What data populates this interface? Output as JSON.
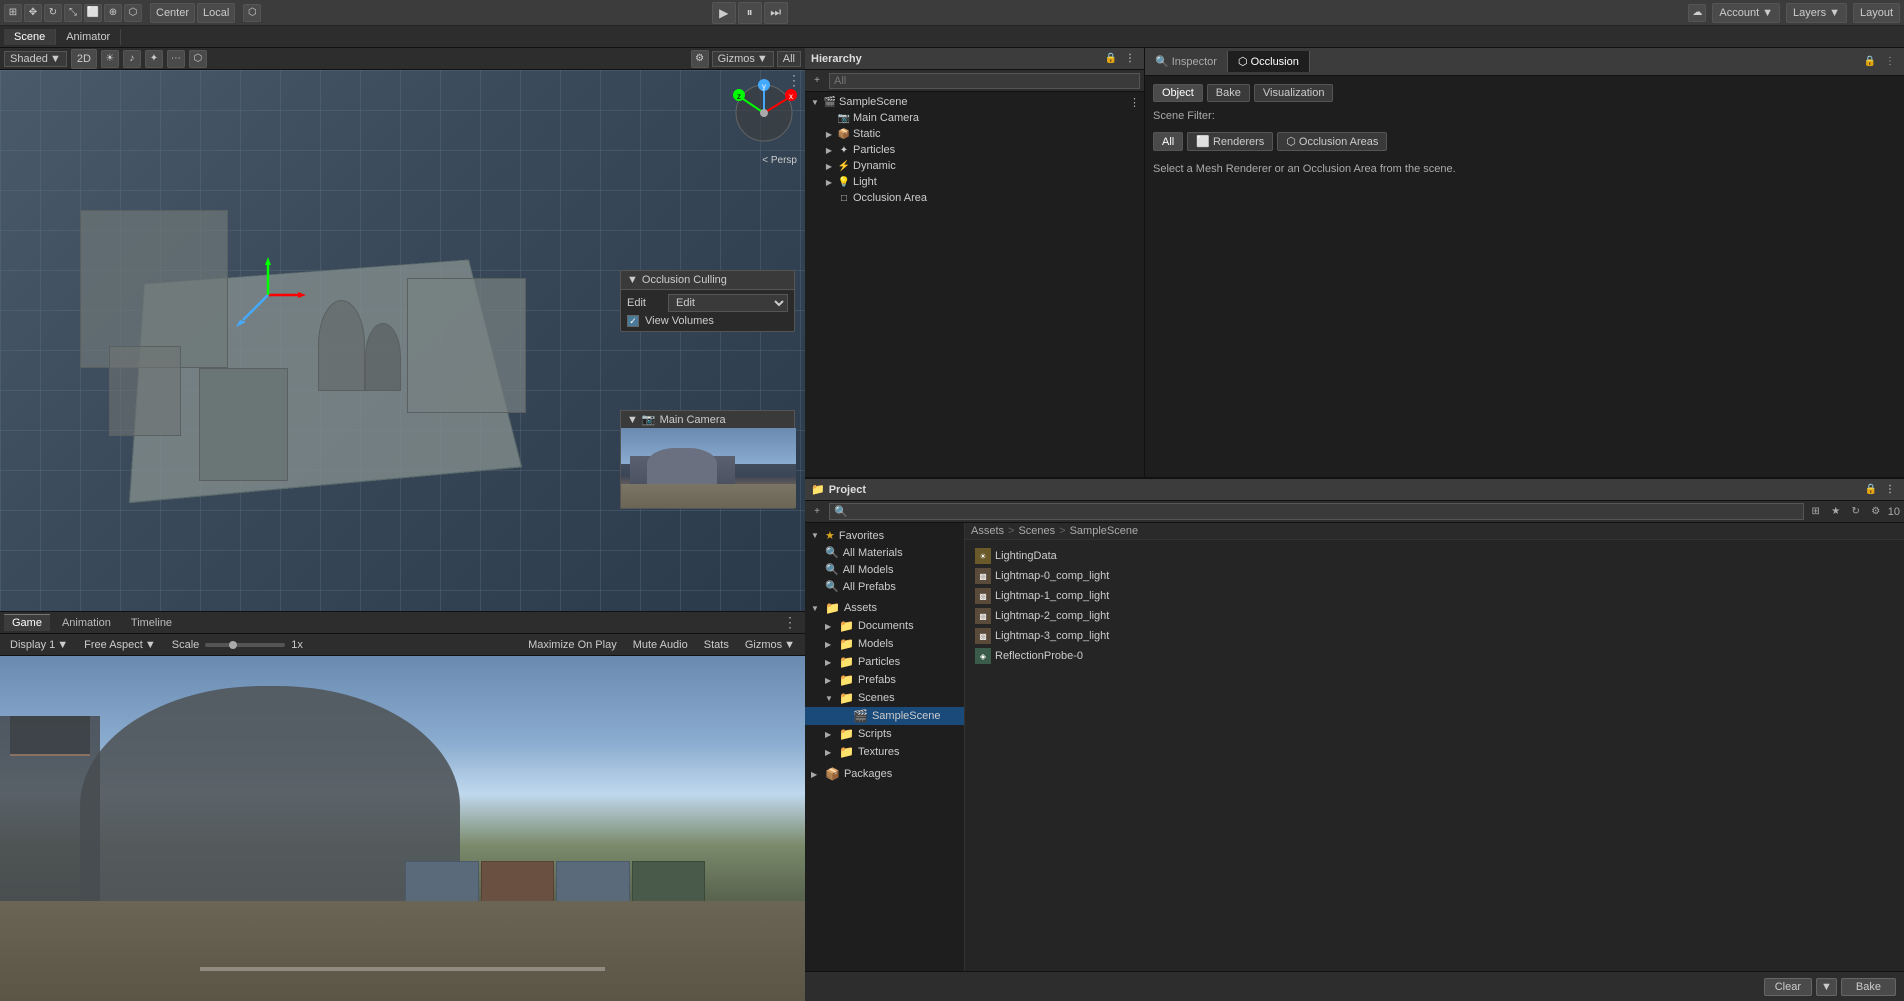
{
  "toolbar": {
    "scene_label": "Scene",
    "animator_label": "Animator",
    "shaded_label": "Shaded",
    "twod_label": "2D",
    "gizmos_label": "Gizmos",
    "all_label": "All",
    "center_label": "Center",
    "local_label": "Local",
    "play_icon": "▶",
    "pause_icon": "⏸",
    "step_icon": "⏭",
    "account_label": "Account",
    "layers_label": "Layers",
    "layout_label": "Layout"
  },
  "hierarchy": {
    "title": "Hierarchy",
    "search_placeholder": "All",
    "items": [
      {
        "label": "SampleScene",
        "indent": 0,
        "icon": "🎬",
        "arrow": "▼"
      },
      {
        "label": "Main Camera",
        "indent": 1,
        "icon": "📷",
        "arrow": ""
      },
      {
        "label": "Static",
        "indent": 1,
        "icon": "▶",
        "arrow": "▶"
      },
      {
        "label": "Particles",
        "indent": 1,
        "icon": "▶",
        "arrow": "▶"
      },
      {
        "label": "Dynamic",
        "indent": 1,
        "icon": "▶",
        "arrow": "▶"
      },
      {
        "label": "Light",
        "indent": 1,
        "icon": "💡",
        "arrow": "▶"
      },
      {
        "label": "Occlusion Area",
        "indent": 1,
        "icon": "□",
        "arrow": ""
      }
    ]
  },
  "inspector": {
    "title": "Inspector",
    "tab_label": "Inspector"
  },
  "occlusion": {
    "title": "Occlusion",
    "tab_label": "Occlusion",
    "object_btn": "Object",
    "bake_btn": "Bake",
    "visualization_btn": "Visualization",
    "scene_filter_label": "Scene Filter:",
    "all_btn": "All",
    "renderers_btn": "Renderers",
    "occlusion_areas_btn": "Occlusion Areas",
    "info_text": "Select a Mesh Renderer or an Occlusion Area from the scene."
  },
  "scene_view": {
    "shaded_label": "Shaded",
    "twod_label": "2D",
    "gizmos_label": "Gizmos",
    "all_label": "All",
    "persp_label": "< Persp",
    "occlusion_culling": {
      "title": "Occlusion Culling",
      "edit_label": "Edit",
      "view_volumes_label": "View Volumes"
    },
    "camera_preview": {
      "title": "Main Camera"
    }
  },
  "game_view": {
    "game_tab": "Game",
    "animation_tab": "Animation",
    "timeline_tab": "Timeline",
    "display_label": "Display 1",
    "aspect_label": "Free Aspect",
    "scale_label": "Scale",
    "scale_value": "1x",
    "maximize_label": "Maximize On Play",
    "mute_label": "Mute Audio",
    "stats_label": "Stats",
    "gizmos_label": "Gizmos"
  },
  "project": {
    "title": "Project",
    "breadcrumb": [
      "Assets",
      "Scenes",
      "SampleScene"
    ],
    "favorites": {
      "label": "Favorites",
      "items": [
        "All Materials",
        "All Models",
        "All Prefabs"
      ]
    },
    "assets": {
      "label": "Assets",
      "items": [
        {
          "label": "Documents",
          "indent": 1
        },
        {
          "label": "Models",
          "indent": 1
        },
        {
          "label": "Particles",
          "indent": 1
        },
        {
          "label": "Prefabs",
          "indent": 1
        },
        {
          "label": "Scenes",
          "indent": 1,
          "expanded": true
        },
        {
          "label": "SampleScene",
          "indent": 2
        },
        {
          "label": "Scripts",
          "indent": 1
        },
        {
          "label": "Textures",
          "indent": 1
        }
      ]
    },
    "packages": {
      "label": "Packages"
    },
    "files": [
      {
        "label": "LightingData",
        "type": "lighting"
      },
      {
        "label": "Lightmap-0_comp_light",
        "type": "lightmap"
      },
      {
        "label": "Lightmap-1_comp_light",
        "type": "lightmap"
      },
      {
        "label": "Lightmap-2_comp_light",
        "type": "lightmap"
      },
      {
        "label": "Lightmap-3_comp_light",
        "type": "lightmap"
      },
      {
        "label": "ReflectionProbe-0",
        "type": "reflection"
      }
    ]
  },
  "bottom_bar": {
    "clear_label": "Clear",
    "bake_label": "Bake"
  }
}
